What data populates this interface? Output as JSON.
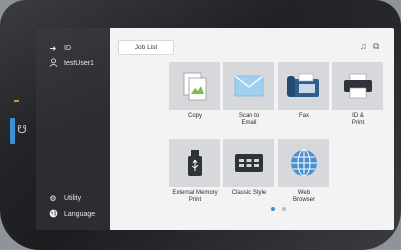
{
  "sidebar": {
    "id_label": "ID",
    "user_label": "testUser1",
    "utility_label": "Utility",
    "language_label": "Language"
  },
  "header": {
    "job_list_label": "Job List"
  },
  "tiles": [
    {
      "label": "Copy",
      "icon": "copy-icon"
    },
    {
      "label": "Scan to\nEmail",
      "icon": "email-icon"
    },
    {
      "label": "Fax",
      "icon": "fax-icon"
    },
    {
      "label": "ID &\nPrint",
      "icon": "printer-icon"
    },
    {
      "label": "External Memory\nPrint",
      "icon": "usb-icon"
    },
    {
      "label": "Classic Style",
      "icon": "keyboard-icon"
    },
    {
      "label": "Web\nBrowser",
      "icon": "globe-icon"
    }
  ],
  "pager": {
    "current": 1,
    "total": 2
  },
  "colors": {
    "accent": "#3a8fd8",
    "sidebar_bg": "#2b2d31",
    "main_bg": "#f3f3f3",
    "tile_bg": "#d6d8db",
    "led": "#d08a2c"
  }
}
